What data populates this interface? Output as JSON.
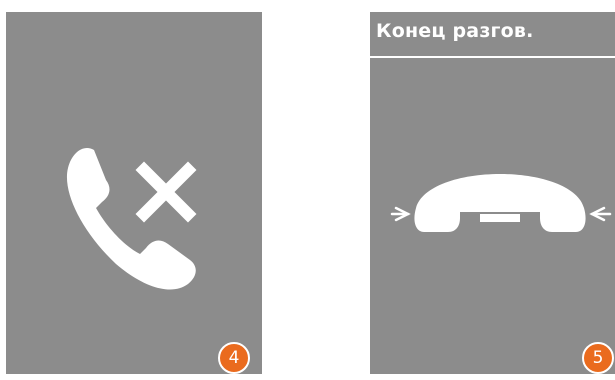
{
  "screens": [
    {
      "step_badge": "4",
      "icon": "call-rejected-icon",
      "background": "#8c8c8c"
    },
    {
      "title": "Конец разгов.",
      "step_badge": "5",
      "icon": "hang-up-handset-icon",
      "background": "#8c8c8c"
    }
  ],
  "colors": {
    "screen_bg": "#8c8c8c",
    "foreground": "#ffffff",
    "badge": "#ea6b1e"
  }
}
